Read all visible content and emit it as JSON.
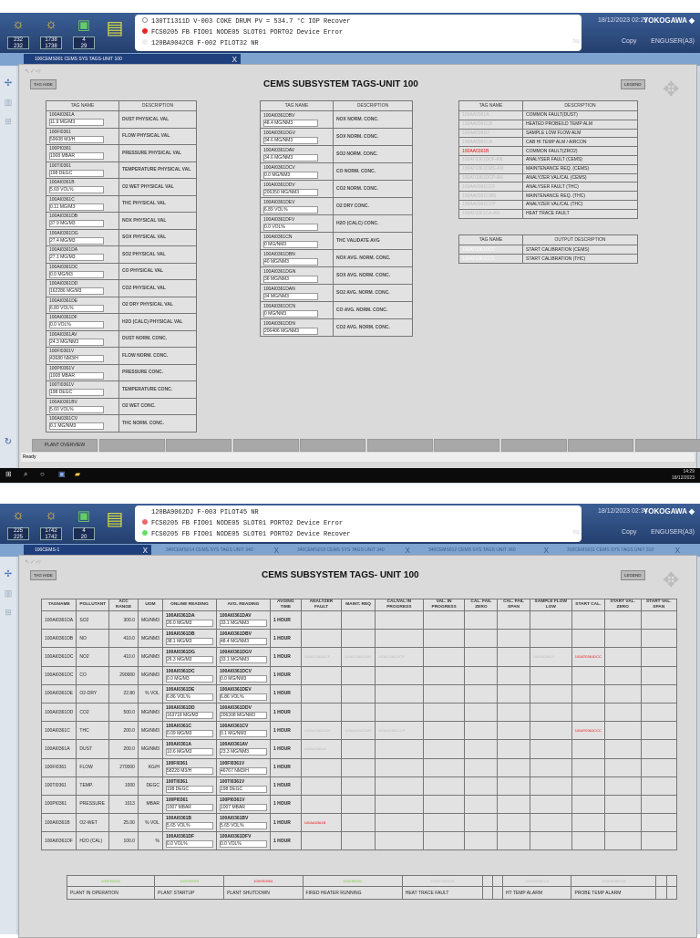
{
  "screens": [
    {
      "counters": [
        [
          "232",
          "232"
        ],
        [
          "1738",
          "1738"
        ],
        [
          "4",
          "29"
        ]
      ],
      "alarms": [
        {
          "text": "130TI1311D   V-003        COKE DRUM    PV  =  534.7 °C    IOP  Recover",
          "color": "#ffffff"
        },
        {
          "text": "FCS0205  FB FIO01 NODE05 SLOT01 PORT02 Device Error",
          "color": "#e22222"
        },
        {
          "text": "120BA9042CB       F-002 PILOT32 NR",
          "color": "#ffffff"
        }
      ],
      "datetime": "18/12/2023 02:29",
      "brand": "YOKOGAWA ◆",
      "copy": "Copy",
      "user": "ENGUSER(A3)",
      "tabs": [
        {
          "label": "100CEMS001 CEMS SYS TAGS-UNIT 100",
          "close": "X"
        }
      ],
      "title": "CEMS SUBSYSTEM TAGS-UNIT 100",
      "tag_hide": "TAG HIDE",
      "legend": "LEGEND",
      "status": "Ready",
      "clock": "14:29",
      "date": "18/12/2023",
      "nav": [
        "PLANT OVERVIEW",
        "",
        "",
        "",
        "",
        "",
        "",
        "",
        "",
        ""
      ]
    },
    {
      "counters": [
        [
          "225",
          "225"
        ],
        [
          "1742",
          "1742"
        ],
        [
          "4",
          "20"
        ]
      ],
      "alarms": [
        {
          "text": "120BA9062DJ       F-003 PILOT45 NR",
          "color": "#ffffff"
        },
        {
          "text": "FCS0205  FB FIO01 NODE05 SLOT01 PORT02 Device Error",
          "color": "#e22222"
        },
        {
          "text": "FCS0205  FB FIO01 NODE05 SLOT01 PORT02 Device Recover",
          "color": "#55dd55"
        }
      ],
      "datetime": "18/12/2023 02:34",
      "brand": "YOKOGAWA ◆",
      "copy": "Copy",
      "user": "ENGUSER(A3)",
      "tabs": [
        {
          "label": "100CEMS-1",
          "close": "X"
        },
        {
          "label": "340CEMS014 CEMS SYS TAGS UNIT 340",
          "close": "X"
        },
        {
          "label": "340CEMS013 CEMS SYS TAGS UNIT 340",
          "close": "X"
        },
        {
          "label": "340CEMS012 CEMS SYS TAGS UNIT 340",
          "close": "X"
        },
        {
          "label": "310CEMS011 CEMS SYS TAGS UNIT 310",
          "close": "X"
        }
      ],
      "title": "CEMS SUBSYSTEM TAGS- UNIT 100",
      "tag_hide": "TAG HIDE",
      "legend": "LEGEND"
    }
  ],
  "t1": {
    "headers": [
      "TAG NAME",
      "DESCRIPTION"
    ],
    "rows": [
      [
        "100AI0361A",
        "11.9  MG/M3",
        "DUST      PHYSICAL VAL"
      ],
      [
        "100FI0361",
        "59608 M3/H",
        "FLOW      PHYSICAL VAL"
      ],
      [
        "100PI0361",
        "1008  MBAR",
        "PRESSURE   PHYSICAL VAL"
      ],
      [
        "100TI0361",
        "198   DEGC",
        "TEMPERATURE PHYSICAL VAL"
      ],
      [
        "100AI0361B",
        "5.69  VOL%",
        "O2 WET    PHYSICAL VAL"
      ],
      [
        "100AI0361C",
        "0.11  MG/M3",
        "THC       PHYSICAL VAL"
      ],
      [
        "100AI0361DB",
        "37.9  MG/M3",
        "NOX       PHYSICAL VAL"
      ],
      [
        "100AI0361DG",
        "27.4  MG/M3",
        "SOX       PHYSICAL VAL"
      ],
      [
        "100AI0361DA",
        "27.1  MG/M3",
        "SO2       PHYSICAL VAL"
      ],
      [
        "100AI0361DC",
        "0.0   MG/M3",
        "CO        PHYSICAL VAL"
      ],
      [
        "100AI0361DD",
        "162286 MG/M3",
        "CO2       PHYSICAL VAL"
      ],
      [
        "100AI0361DE",
        "6.89  VOL%",
        "O2 DRY    PHYSICAL VAL"
      ],
      [
        "100AI0361DF",
        "0.0   VOL%",
        "H2O (CALC) PHYSICAL VAL"
      ],
      [
        "100AI0361AV",
        "24.3  MG/NM3",
        "DUST NORM.  CONC."
      ],
      [
        "100FI0361V",
        "43680 NM3/H",
        "FLOW NORM.  CONC."
      ],
      [
        "100PI0361V",
        "1008  MBAR",
        "PRESSURE    CONC."
      ],
      [
        "100TI0361V",
        "198   DEGC",
        "TEMPERATURE CONC."
      ],
      [
        "100AI0361BV",
        "5.60  VOL%",
        "O2 WET     CONC."
      ],
      [
        "100AI0361CV",
        "0.1   MG/NM3",
        "THC NORM.   CONC."
      ]
    ]
  },
  "t2": {
    "headers": [
      "TAG NAME",
      "DESCRIPTION"
    ],
    "rows": [
      [
        "100AI0361DBV",
        "48.4  MG/NM3",
        "NOX NORM.  CONC."
      ],
      [
        "100AI0361DGV",
        "34.6  MG/NM3",
        "SOX NORM.  CONC."
      ],
      [
        "100AI0361DAV",
        "34.6  MG/NM3",
        "SO2 NORM.  CONC."
      ],
      [
        "100AI0361DCV",
        "0.0   MG/NM3",
        "CO  NORM.  CONC."
      ],
      [
        "100AI0361DDV",
        "206350 MG/NM3",
        "CO2 NORM.  CONC."
      ],
      [
        "100AI0361DEV",
        "6.89  VOL%",
        "O2 DRY    CONC."
      ],
      [
        "100AI0361DFV",
        "0.0   VOL%",
        "H2O (CALC)  CONC."
      ],
      [
        "100AI0361CN",
        "0     MG/NM3",
        "THC       VALIDATE AVG"
      ],
      [
        "100AI0361DBN",
        "40    MG/NM3",
        "NOX AVG.   NORM. CONC."
      ],
      [
        "100AI0361DGN",
        "36    MG/NM3",
        "SOX AVG.   NORM. CONC."
      ],
      [
        "100AI0361DAN",
        "34    MG/NM3",
        "SO2 AVG.   NORM. CONC."
      ],
      [
        "100AI0361DCN",
        "0     MG/NM3",
        "CO AVG.    NORM. CONC."
      ],
      [
        "100AI0361DDN",
        "206406 MG/NM3",
        "CO2 AVG.   NORM. CONC."
      ]
    ]
  },
  "t3": {
    "headers": [
      "TAG NAME",
      "DESCRIPTION"
    ],
    "rows": [
      [
        "100AA0361A",
        "COMMON FAULT(DUST)",
        "faded"
      ],
      [
        "100AA0361CB",
        "HEATED PROBE/LD TEMP ALM",
        "faded"
      ],
      [
        "100AA0361D",
        "SAMPLE LOW FLOW ALM",
        "faded"
      ],
      [
        "100AA0361CA",
        "CAB HI TEMP ALM / AIRCON",
        "faded"
      ],
      [
        "100AA0361B",
        "COMMON FAULT(ZRO2)",
        "red"
      ],
      [
        "100AT0361DCF-AN",
        "ANALYSER  FAULT (CEMS)",
        "faded"
      ],
      [
        "100AT0361CMS-AN",
        "MAINTENANCE REQ. (CEMS)",
        "faded"
      ],
      [
        "100AT0361DCP-AN",
        "ANALYZER VAL/CAL (CEMS)",
        "faded"
      ],
      [
        "100AA0361CCF",
        "ANALYSER  FAULT (THC)",
        "faded"
      ],
      [
        "100AA0361CMS",
        "MAINTENANCE REQ. (THC)",
        "faded"
      ],
      [
        "100AA0361CCP",
        "ANALYZER VAL/CAL (THC)",
        "faded"
      ],
      [
        "100AT0361CA-AN",
        "HEAT TRACE FAULT",
        "faded"
      ]
    ]
  },
  "t4": {
    "headers": [
      "TAG NAME",
      "OUTPUT DESCRIPTION"
    ],
    "rows": [
      [
        "100AT0361DCC",
        "START CALIBRATION (CEMS)"
      ],
      [
        "100AT0361CCC",
        "START CALIBRATION (THC)"
      ]
    ]
  },
  "big": {
    "headers": [
      "TAGNAME",
      "POLLUTANT",
      "ACC RANGE",
      "UOM",
      "ONLINE READING",
      "AVG. READING",
      "AVGING TIME",
      "ANALYZER FAULT",
      "MAINT. REQ",
      "CAL/VAL IN PROGRESS",
      "VAL. IN PROGRESS",
      "CAL. FAIL ZERO",
      "CAL. FAIL SPAN",
      "SAMPLE FLOW LOW",
      "START CAL.",
      "START VAL. ZERO",
      "START VAL. SPAN"
    ],
    "rows": [
      [
        "100AI0361DA",
        "SO2",
        "300.0",
        "MG/NM3",
        "100AI0361DA",
        "26.0  MG/M3",
        "100AI0361DAV",
        "33.1  MG/NM3",
        "1 HOUR"
      ],
      [
        "100AI0361DB",
        "NO",
        "410.0",
        "MG/NM3",
        "100AI0361DB",
        "38.1  MG/M3",
        "100AI0361DBV",
        "48.4  MG/NM3",
        "1 HOUR"
      ],
      [
        "100AI0361DC",
        "NO2",
        "410.0",
        "MG/NM3",
        "100AI0361DG",
        "26.3  MG/M3",
        "100AI0361DGV",
        "33.1  MG/NM3",
        "1 HOUR"
      ],
      [
        "100AI0361DC",
        "CO",
        "290000",
        "MG/NM3",
        "100AI0361DC",
        "0.0   MG/M3",
        "100AI0361DCV",
        "0.0   MG/NM3",
        "1 HOUR"
      ],
      [
        "100AI0361DE",
        "O2-DRY",
        "22.80",
        "% VOL",
        "100AI0361DE",
        "6.86  VOL%",
        "100AI0361DEV",
        "6.86  VOL%",
        "1 HOUR"
      ],
      [
        "100AI0361DD",
        "CO2",
        "500.0",
        "MG/NM3",
        "100AI0361DD",
        "163718 MG/M3",
        "100AI0361DDV",
        "206308 MG/NM3",
        "1 HOUR"
      ],
      [
        "100AI0361C",
        "THC",
        "200.0",
        "MG/NM3",
        "100AI0361C",
        "0.09  MG/M3",
        "100AI0361CV",
        "0.1   MG/NM3",
        "1 HOUR"
      ],
      [
        "100AI0361A",
        "DUST",
        "200.0",
        "MG/NM3",
        "100AI0361A",
        "10.6  MG/M3",
        "100AI0361AV",
        "23.3  MG/NM3",
        "1 HOUR"
      ],
      [
        "100FI0361",
        "FLOW",
        "270000",
        "KG/H",
        "100FI0361",
        "58228 M3/H",
        "100FI0361V",
        "46767 NM3/H",
        "1 HOUR"
      ],
      [
        "100TI0361",
        "TEMP.",
        "1000",
        "DEGC",
        "100TI0361",
        "198   DEGC",
        "100TI0361V",
        "198   DEGC",
        "1 HOUR"
      ],
      [
        "100PI0361",
        "PRESSURE",
        "1013",
        "MBAR",
        "100PI0361",
        "1007  MBAR",
        "100PI0361V",
        "1007  MBAR",
        "1 HOUR"
      ],
      [
        "100AI0361B",
        "O2-WET",
        "25.00",
        "% VOL",
        "100AI0361B",
        "5.65  VOL%",
        "100AI0361BV",
        "5.65  VOL%",
        "1 HOUR"
      ],
      [
        "100AI0361DF",
        "H2O (CAL)",
        "100.0",
        "%",
        "100AI0361DF",
        "0.0   VOL%",
        "100AI0361DFV",
        "0.0   VOL%",
        "1 HOUR"
      ]
    ],
    "flags": [
      {
        "row": 2,
        "col": 7,
        "text": "100AT0361DCF",
        "style": "faded"
      },
      {
        "row": 2,
        "col": 8,
        "text": "100AT0361CMS",
        "style": "faded"
      },
      {
        "row": 2,
        "col": 9,
        "text": "100AT0361DCP",
        "style": "faded"
      },
      {
        "row": 2,
        "col": 13,
        "text": "100FA0361S",
        "style": "faded"
      },
      {
        "row": 2,
        "col": 14,
        "text": "100AT0361DCC",
        "style": "red"
      },
      {
        "row": 6,
        "col": 7,
        "text": "100AA0361CCF",
        "style": "faded"
      },
      {
        "row": 6,
        "col": 8,
        "text": "100AA0361CMS",
        "style": "faded"
      },
      {
        "row": 6,
        "col": 9,
        "text": "100AA0361CCP",
        "style": "faded"
      },
      {
        "row": 6,
        "col": 14,
        "text": "100AT0361CCC",
        "style": "red"
      },
      {
        "row": 7,
        "col": 7,
        "text": "100AA0361A",
        "style": "faded"
      },
      {
        "row": 11,
        "col": 7,
        "text": "100AA0361B",
        "style": "red"
      }
    ]
  },
  "legend_tbl": {
    "tags": [
      {
        "t": "100XS0002",
        "s": "grn"
      },
      {
        "t": "100XS0003",
        "s": "grn"
      },
      {
        "t": "100XS0004",
        "s": "red"
      },
      {
        "t": "100XS0001",
        "s": "grn"
      },
      {
        "t": "100AT0361CA",
        "s": "faded"
      },
      {
        "t": "",
        "s": ""
      },
      {
        "t": "",
        "s": ""
      },
      {
        "t": "100AA0361CA",
        "s": "faded"
      },
      {
        "t": "100AA0361CB",
        "s": "faded"
      },
      {
        "t": "",
        "s": ""
      },
      {
        "t": "",
        "s": ""
      }
    ],
    "labels": [
      "PLANT IN OPERATION",
      "PLANT STARTUP",
      "PLANT SHUTDOWN",
      "FIRED HEATER RUNNING",
      "HEAT TRACE FAULT",
      "",
      "",
      "HT TEMP ALARM",
      "PROBE TEMP ALARM",
      "",
      ""
    ]
  }
}
